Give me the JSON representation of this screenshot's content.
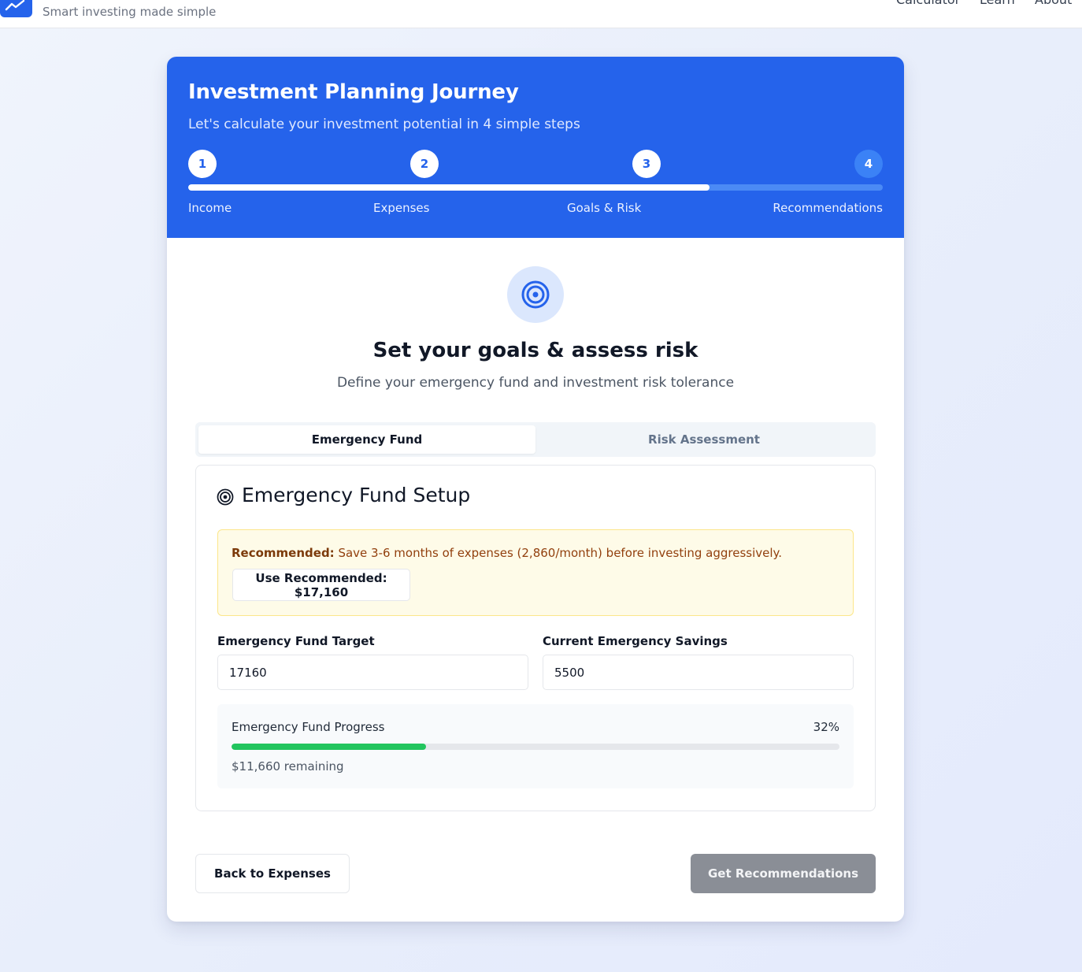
{
  "nav": {
    "tagline": "Smart investing made simple",
    "links": [
      "Calculator",
      "Learn",
      "About"
    ]
  },
  "header": {
    "title": "Investment Planning Journey",
    "subtitle": "Let's calculate your investment potential in 4 simple steps",
    "steps": [
      {
        "number": "1",
        "label": "Income",
        "state": "complete"
      },
      {
        "number": "2",
        "label": "Expenses",
        "state": "complete"
      },
      {
        "number": "3",
        "label": "Goals & Risk",
        "state": "current"
      },
      {
        "number": "4",
        "label": "Recommendations",
        "state": "pending"
      }
    ],
    "progress_fraction": 0.75
  },
  "section": {
    "title": "Set your goals & assess risk",
    "subtitle": "Define your emergency fund and investment risk tolerance"
  },
  "tabs": [
    {
      "label": "Emergency Fund",
      "active": true
    },
    {
      "label": "Risk Assessment",
      "active": false
    }
  ],
  "emergency": {
    "title": "Emergency Fund Setup",
    "recommended_label": "Recommended:",
    "recommended_text": " Save 3-6 months of expenses (2,860/month) before investing aggressively.",
    "use_button": "Use Recommended: $17,160",
    "target_label": "Emergency Fund Target",
    "target_value": "17160",
    "savings_label": "Current Emergency Savings",
    "savings_value": "5500",
    "progress_label": "Emergency Fund Progress",
    "progress_percent": "32%",
    "progress_fraction": 0.32,
    "remaining": "$11,660 remaining"
  },
  "actions": {
    "back": "Back to Expenses",
    "next": "Get Recommendations"
  },
  "colors": {
    "accent": "#2563eb",
    "progress_green": "#22c55e",
    "disabled_button": "#8a8e96"
  }
}
